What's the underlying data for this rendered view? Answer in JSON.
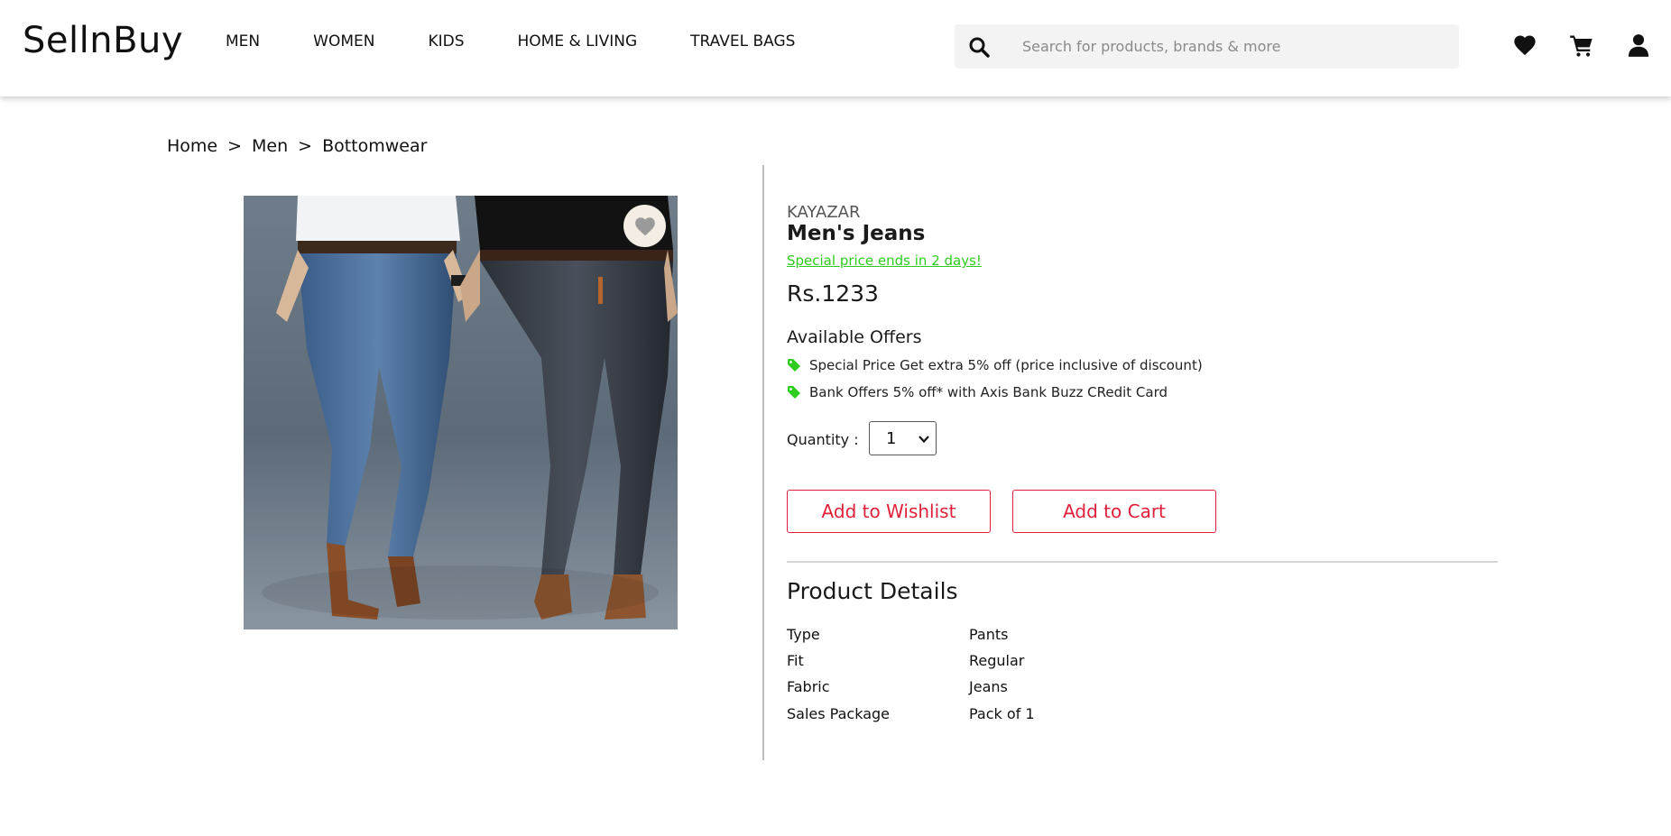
{
  "header": {
    "logo": "SellnBuy",
    "nav": [
      "MEN",
      "WOMEN",
      "KIDS",
      "HOME & LIVING",
      "TRAVEL BAGS"
    ],
    "search": {
      "placeholder": "Search for products, brands & more",
      "value": ""
    },
    "icons": [
      "search-icon",
      "heart-icon",
      "cart-icon",
      "user-icon"
    ]
  },
  "breadcrumb": [
    "Home",
    "Men",
    "Bottomwear"
  ],
  "breadcrumb_separator": ">",
  "product": {
    "brand": "KAYAZAR",
    "name": "Men's Jeans",
    "special_note": "Special price ends in 2 days!",
    "price": "Rs.1233",
    "offers_title": "Available Offers",
    "offers": [
      "Special Price Get extra 5% off (price inclusive of discount)",
      "Bank Offers 5% off* with Axis Bank Buzz CRedit Card"
    ],
    "quantity_label": "Quantity :",
    "quantity_value": "1",
    "wishlist_button": "Add to Wishlist",
    "cart_button": "Add to Cart",
    "details_title": "Product Details",
    "details": [
      {
        "key": "Type",
        "value": "Pants"
      },
      {
        "key": "Fit",
        "value": "Regular"
      },
      {
        "key": "Fabric",
        "value": "Jeans"
      },
      {
        "key": "Sales Package",
        "value": "Pack of 1"
      }
    ]
  },
  "colors": {
    "accent_red": "#e0203a",
    "offer_green": "#2ecc1f",
    "search_bg": "#f3f3f3"
  }
}
